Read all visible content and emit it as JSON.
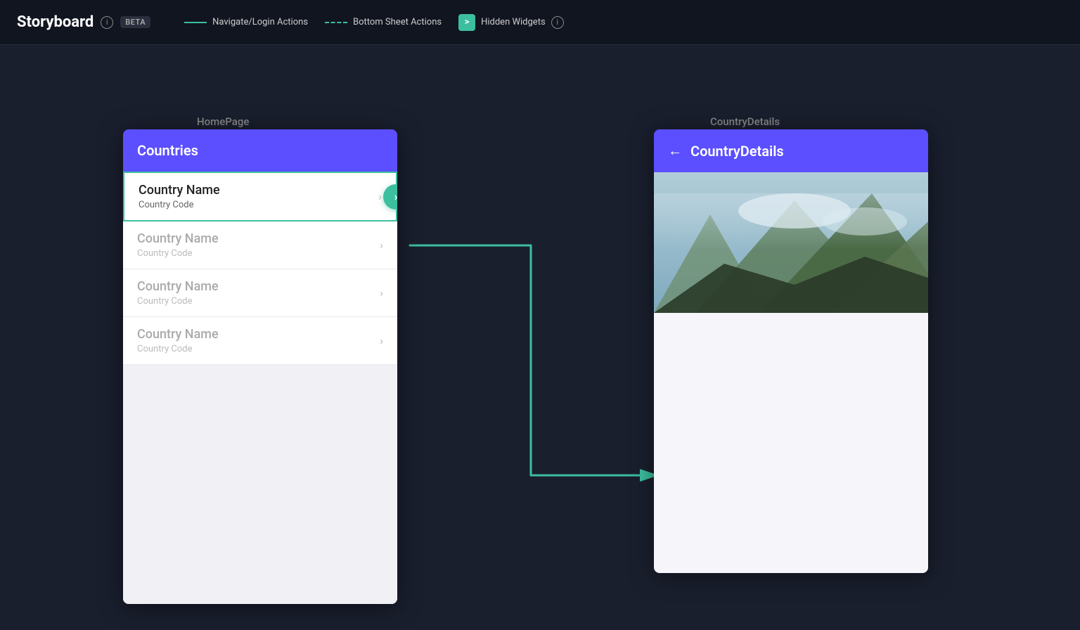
{
  "topbar": {
    "title": "Storyboard",
    "beta_label": "BETA",
    "info_icon": "ⓘ",
    "legend": {
      "navigate_label": "Navigate/Login Actions",
      "bottom_sheet_label": "Bottom Sheet Actions",
      "hidden_widgets_label": "Hidden Widgets",
      "hidden_widgets_icon": ">"
    }
  },
  "pages": {
    "home": {
      "label": "HomePage",
      "app_bar_title": "Countries",
      "items": [
        {
          "name": "Country Name",
          "code": "Country Code",
          "selected": true
        },
        {
          "name": "Country Name",
          "code": "Country Code",
          "selected": false
        },
        {
          "name": "Country Name",
          "code": "Country Code",
          "selected": false
        },
        {
          "name": "Country Name",
          "code": "Country Code",
          "selected": false
        }
      ]
    },
    "detail": {
      "label": "CountryDetails",
      "app_bar_title": "CountryDetails",
      "back_arrow": "←"
    }
  },
  "colors": {
    "accent": "#3cbf9f",
    "purple": "#5b4fff",
    "dark_bg": "#1a1f2e"
  }
}
